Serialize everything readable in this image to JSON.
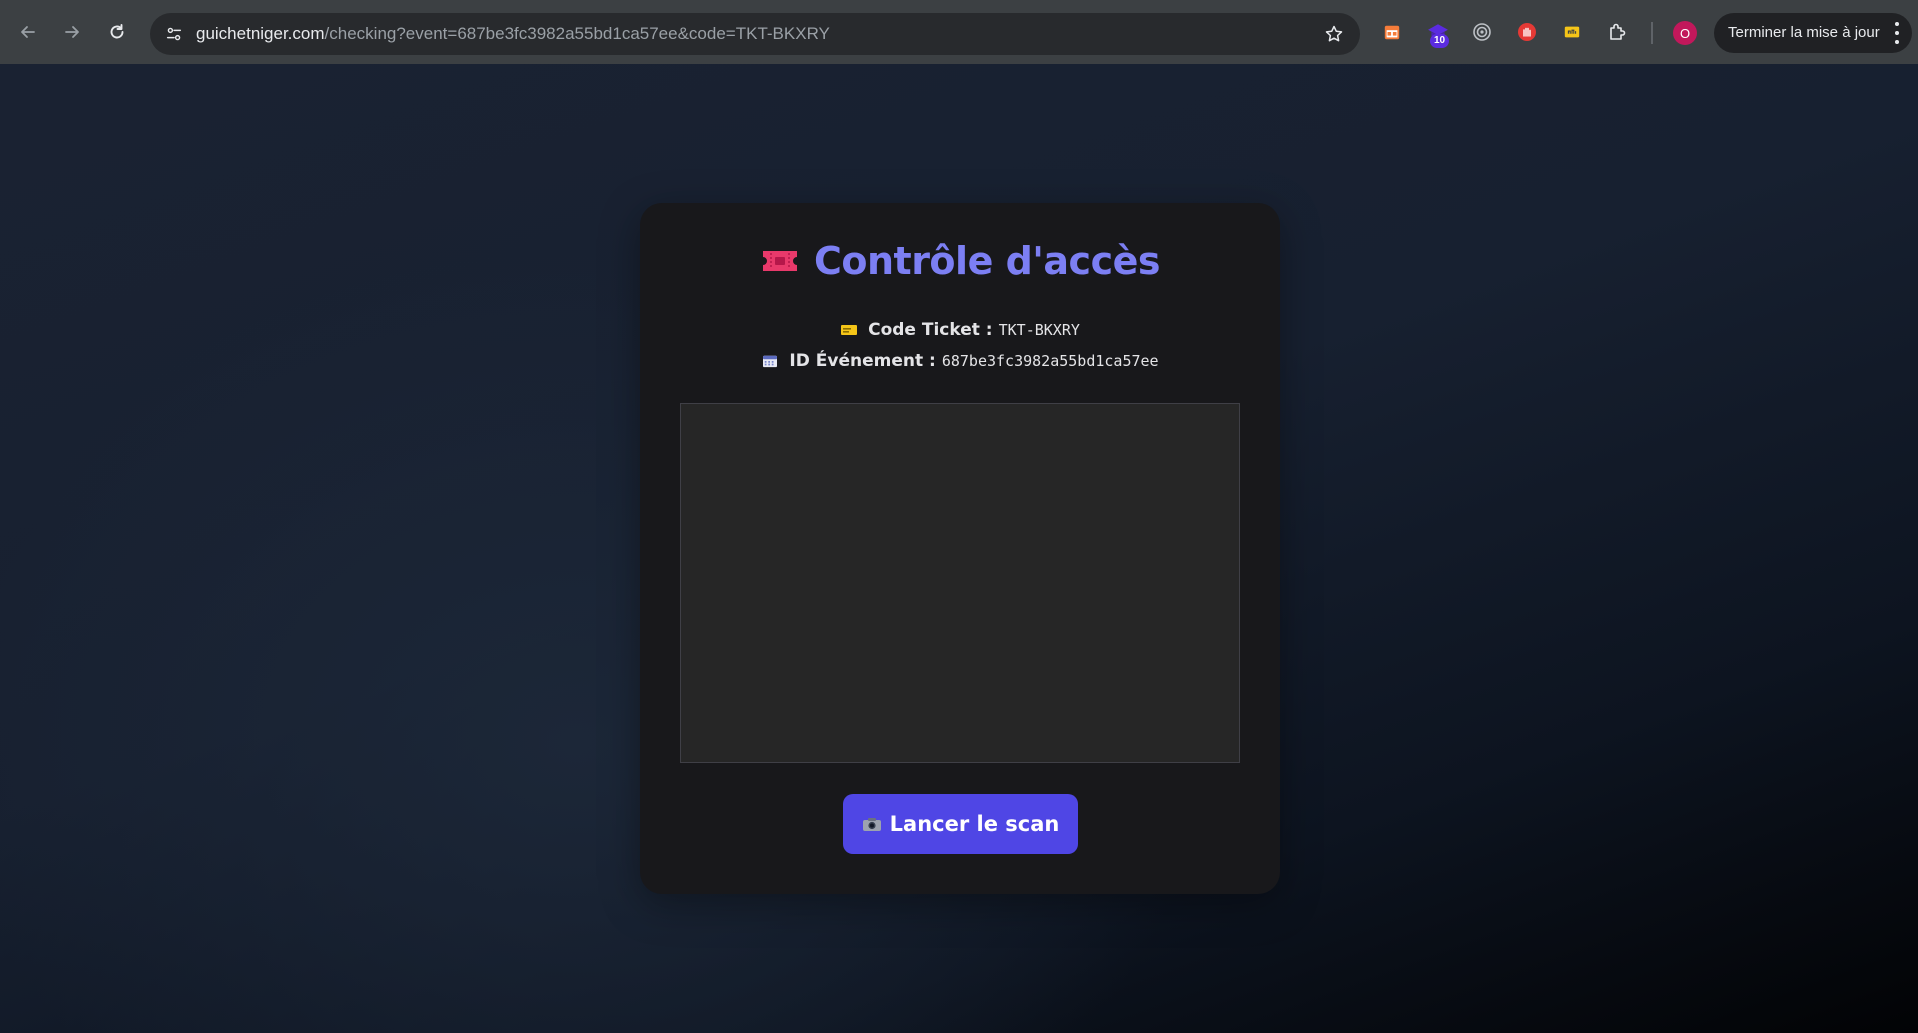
{
  "browser": {
    "url_host": "guichetniger.com",
    "url_rest": "/checking?event=687be3fc3982a55bd1ca57ee&code=TKT-BKXRY",
    "extension_badge": "10",
    "avatar_letter": "O",
    "update_button_label": "Terminer la mise à jour"
  },
  "page": {
    "title": "Contrôle d'accès",
    "ticket_code_label": "Code Ticket :",
    "ticket_code_value": "TKT-BKXRY",
    "event_id_label": "ID Événement :",
    "event_id_value": "687be3fc3982a55bd1ca57ee",
    "scan_button_label": "Lancer le scan"
  },
  "colors": {
    "title": "#7c7ff3",
    "button": "#4f46e5",
    "card": "#18181b"
  }
}
